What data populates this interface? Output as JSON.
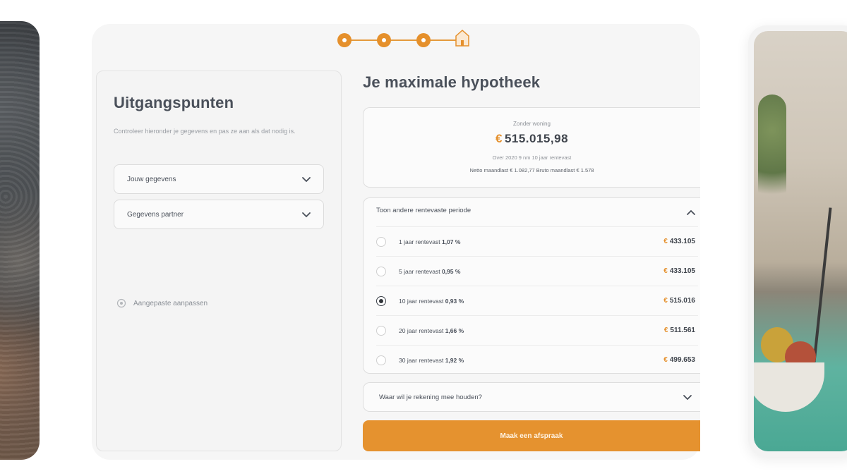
{
  "stepper": {
    "steps": 4,
    "current": 4
  },
  "left_panel": {
    "title": "Uitgangspunten",
    "intro": "Controleer hieronder je gegevens en pas ze aan als dat nodig is.",
    "accordions": [
      {
        "label": "Jouw gegevens"
      },
      {
        "label": "Gegevens partner"
      }
    ],
    "link": "Aangepaste aanpassen"
  },
  "right_panel": {
    "title": "Je maximale hypotheek",
    "summary": {
      "caption": "Zonder woning",
      "currency": "€",
      "amount": "515.015,98",
      "meta": "Over 2020 9 nm 10 jaar rentevast",
      "meta2": "Netto maandlast € 1.082,77   Bruto maandlast € 1.578"
    },
    "rates": {
      "header": "Toon andere rentevaste periode",
      "rows": [
        {
          "label": "1 jaar rentevast",
          "rate": "1,07 %",
          "currency": "€",
          "value": "433.105",
          "selected": false
        },
        {
          "label": "5 jaar rentevast",
          "rate": "0,95 %",
          "currency": "€",
          "value": "433.105",
          "selected": false
        },
        {
          "label": "10 jaar rentevast",
          "rate": "0,93 %",
          "currency": "€",
          "value": "515.016",
          "selected": true
        },
        {
          "label": "20 jaar rentevast",
          "rate": "1,66 %",
          "currency": "€",
          "value": "511.561",
          "selected": false
        },
        {
          "label": "30 jaar rentevast",
          "rate": "1,92 %",
          "currency": "€",
          "value": "499.653",
          "selected": false
        }
      ]
    },
    "question": "Waar wil je rekening mee houden?",
    "cta": "Maak een afspraak"
  },
  "colors": {
    "accent": "#e5922f",
    "text": "#3a3f47",
    "card": "#f6f6f6"
  },
  "icons": [
    "chevron-down-icon",
    "chevron-up-icon",
    "gear-icon",
    "house-icon"
  ]
}
